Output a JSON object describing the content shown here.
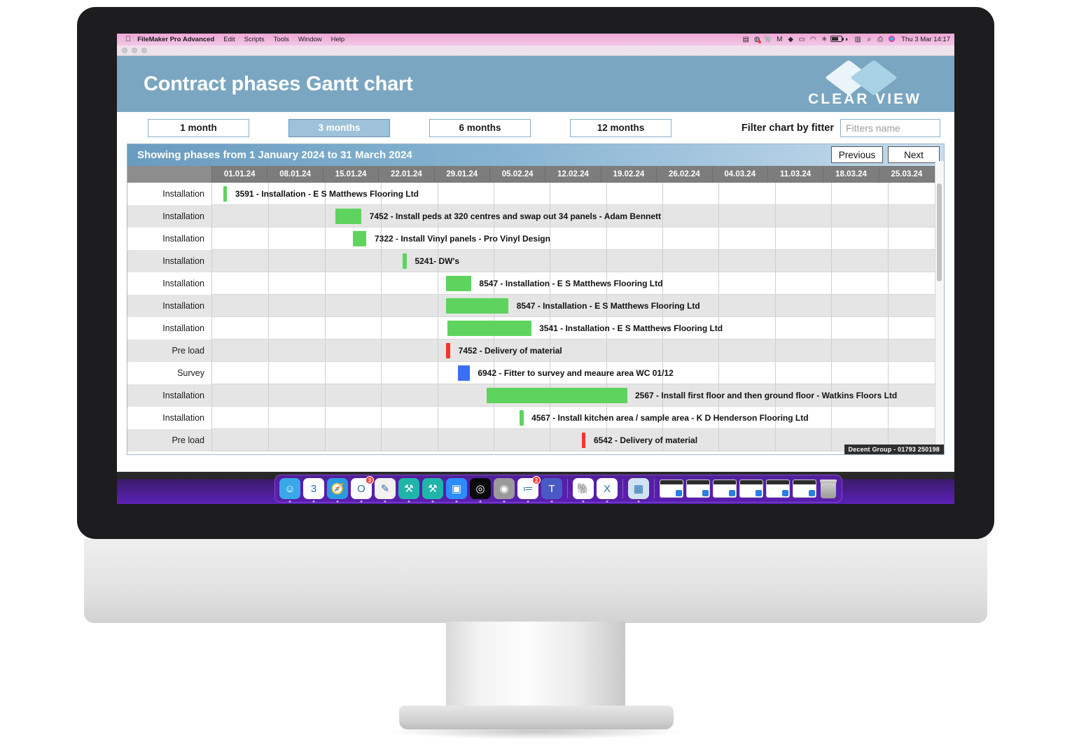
{
  "menubar": {
    "app_name": "FileMaker Pro Advanced",
    "items": [
      "Edit",
      "Scripts",
      "Tools",
      "Window",
      "Help"
    ],
    "status_icons": [
      "display-icon",
      "time-machine-icon",
      "evernote-icon",
      "mailbutler-icon",
      "dropbox-icon",
      "screen-icon",
      "backup-icon",
      "bluetooth-icon",
      "battery-icon",
      "wifi-icon",
      "keyboard-icon",
      "search-icon",
      "airplay-icon",
      "siri-icon"
    ],
    "clock": "Thu 3 Mar  14:17"
  },
  "header": {
    "title": "Contract phases Gantt chart",
    "logo_text": "CLEAR VIEW",
    "bg_color": "#7aa6c2"
  },
  "toolbar": {
    "range_buttons": [
      {
        "label": "1 month",
        "active": false
      },
      {
        "label": "3 months",
        "active": true
      },
      {
        "label": "6 months",
        "active": false
      },
      {
        "label": "12 months",
        "active": false
      }
    ],
    "filter_label": "Filter chart by fitter",
    "filter_placeholder": "Fitters name",
    "filter_value": ""
  },
  "gantt": {
    "range_title": "Showing phases from 1 January 2024 to 31 March 2024",
    "previous_label": "Previous",
    "next_label": "Next",
    "columns": [
      "01.01.24",
      "08.01.24",
      "15.01.24",
      "22.01.24",
      "29.01.24",
      "05.02.24",
      "12.02.24",
      "19.02.24",
      "26.02.24",
      "04.03.24",
      "11.03.24",
      "18.03.24",
      "25.03.24"
    ],
    "bar_colors": {
      "installation": "#5ed45e",
      "pre_load": "#f5342a",
      "survey": "#3b6ff5"
    },
    "rows": [
      {
        "phase": "Installation",
        "text": "3591 - Installation - E S Matthews Flooring Ltd",
        "bar_start_pct": 1.5,
        "bar_width_pct": 0.55,
        "color": "#5ed45e"
      },
      {
        "phase": "Installation",
        "text": "7452 - Install peds at 320 centres and swap out 34 panels - Adam Bennett",
        "bar_start_pct": 16.8,
        "bar_width_pct": 3.6,
        "color": "#5ed45e"
      },
      {
        "phase": "Installation",
        "text": "7322 - Install Vinyl panels - Pro Vinyl Design",
        "bar_start_pct": 19.2,
        "bar_width_pct": 1.9,
        "color": "#5ed45e"
      },
      {
        "phase": "Installation",
        "text": "5241- DW's",
        "bar_start_pct": 26.0,
        "bar_width_pct": 0.6,
        "color": "#5ed45e"
      },
      {
        "phase": "Installation",
        "text": "8547 - Installation - E S Matthews Flooring Ltd",
        "bar_start_pct": 32.0,
        "bar_width_pct": 3.4,
        "color": "#5ed45e"
      },
      {
        "phase": "Installation",
        "text": "8547 - Installation - E S Matthews Flooring Ltd",
        "bar_start_pct": 32.0,
        "bar_width_pct": 8.5,
        "color": "#5ed45e"
      },
      {
        "phase": "Installation",
        "text": "3541 - Installation - E S Matthews Flooring Ltd",
        "bar_start_pct": 32.2,
        "bar_width_pct": 11.4,
        "color": "#5ed45e"
      },
      {
        "phase": "Pre load",
        "text": "7452 - Delivery of material",
        "bar_start_pct": 32.0,
        "bar_width_pct": 0.55,
        "color": "#f5342a"
      },
      {
        "phase": "Survey",
        "text": "6942 - Fitter to survey and meaure area WC 01/12",
        "bar_start_pct": 33.6,
        "bar_width_pct": 1.6,
        "color": "#3b6ff5"
      },
      {
        "phase": "Installation",
        "text": "2567 - Install first floor and then ground floor - Watkins Floors Ltd",
        "bar_start_pct": 37.5,
        "bar_width_pct": 19.2,
        "color": "#5ed45e"
      },
      {
        "phase": "Installation",
        "text": "4567 - Install kitchen area / sample area - K D Henderson Flooring Ltd",
        "bar_start_pct": 42.0,
        "bar_width_pct": 0.55,
        "color": "#5ed45e"
      },
      {
        "phase": "Pre load",
        "text": "6542 - Delivery of material",
        "bar_start_pct": 50.5,
        "bar_width_pct": 0.55,
        "color": "#f5342a"
      }
    ]
  },
  "footer": {
    "credit": "Decent Group - 01793 250198"
  },
  "dock": {
    "apps": [
      {
        "name": "finder-icon",
        "glyph": "☺",
        "bg": "#3aa8e8",
        "badge": ""
      },
      {
        "name": "calendar-icon",
        "glyph": "3",
        "bg": "#ffffff",
        "badge": ""
      },
      {
        "name": "safari-icon",
        "glyph": "🧭",
        "bg": "#2d9ae0",
        "badge": ""
      },
      {
        "name": "outlook-icon",
        "glyph": "O",
        "bg": "#ffffff",
        "badge": "3"
      },
      {
        "name": "notes-icon",
        "glyph": "✎",
        "bg": "#f4f2ee",
        "badge": ""
      },
      {
        "name": "filemaker-icon",
        "glyph": "⚒",
        "bg": "#1fb5a8",
        "badge": ""
      },
      {
        "name": "filemaker-advanced-icon",
        "glyph": "⚒",
        "bg": "#1fb5a8",
        "badge": ""
      },
      {
        "name": "zoom-icon",
        "glyph": "▣",
        "bg": "#2d8cff",
        "badge": ""
      },
      {
        "name": "citrix-icon",
        "glyph": "◎",
        "bg": "#0a0a0a",
        "badge": ""
      },
      {
        "name": "cleanmymac-icon",
        "glyph": "◉",
        "bg": "#9a9a9a",
        "badge": ""
      },
      {
        "name": "reminders-icon",
        "glyph": "≔",
        "bg": "#ffffff",
        "badge": "2"
      },
      {
        "name": "teams-icon",
        "glyph": "T",
        "bg": "#4a5ac4",
        "badge": ""
      },
      {
        "name": "evernote-icon",
        "glyph": "🐘",
        "bg": "#ffffff",
        "badge": ""
      },
      {
        "name": "excel-icon",
        "glyph": "X",
        "bg": "#ffffff",
        "badge": ""
      },
      {
        "name": "photos-icon",
        "glyph": "▦",
        "bg": "#cfe3f2",
        "badge": ""
      }
    ],
    "windows_count": 6,
    "trash_name": "trash-icon"
  }
}
